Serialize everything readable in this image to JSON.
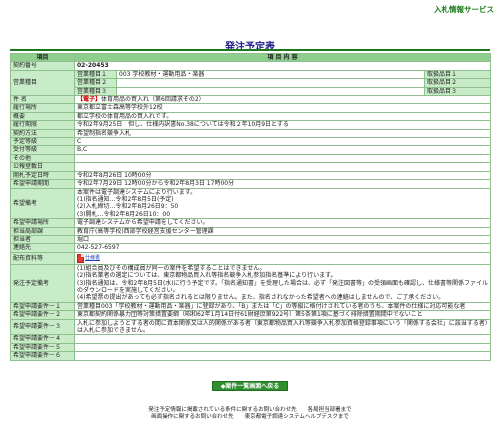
{
  "header": {
    "service": "入札情報サービス"
  },
  "page_title": "発注予定表",
  "table": {
    "head_item": "項目",
    "head_content": "項 目 内 容",
    "case_no": {
      "label": "契約番号",
      "value": "02-20453"
    },
    "category": {
      "label": "営業種目",
      "rows": [
        {
          "name": "営業種目１",
          "value": "003 学校教材・運動用品・楽器",
          "lic": "取扱品目１"
        },
        {
          "name": "営業種目２",
          "value": "",
          "lic": "取扱品目２"
        },
        {
          "name": "営業種目３",
          "value": "",
          "lic": "取扱品目３"
        }
      ]
    },
    "subject": {
      "label": "件 名",
      "tag": "【電子】",
      "value": "体育用品の買入れ（第6回請求その2）"
    },
    "place": {
      "label": "履行場所",
      "value": "東京都立富士森高等学校外12校"
    },
    "summary": {
      "label": "概要",
      "value": "都立学校の体育用品の買入れです。"
    },
    "period": {
      "label": "履行期限",
      "value": "令和2年9月25日　但し、仕様内訳書No.38については令和２年10月9日とする"
    },
    "method": {
      "label": "契約方法",
      "value": "希望制指名競争入札"
    },
    "pre_rank": {
      "label": "予定等級",
      "value": "C"
    },
    "accept_rank": {
      "label": "受付等級",
      "value": "B,C"
    },
    "other": {
      "label": "その他",
      "value": ""
    },
    "bid_date": {
      "label": "公報登載日",
      "value": ""
    },
    "open_date": {
      "label": "開札予定日時",
      "value": "令和2年8月26日 10時00分"
    },
    "apply_period": {
      "label": "希望申請期間",
      "value": "令和2年7月29日 12時00分から令和2年8月3日 17時00分"
    },
    "remarks": {
      "label": "希望備考",
      "lines": [
        "本案件は電子調達システムにより行います。",
        "(1)指名通知…令和2年8月5日(予定)",
        "(2)入札締切…令和2年8月26日9：50",
        "(3)開札…令和2年8月26日10：00"
      ]
    },
    "apply_place": {
      "label": "希望申請場所",
      "value": "電子調達システムから希望申請をしてください。"
    },
    "dept": {
      "label": "担当局部課",
      "value": "教育庁(高等学校)西部学校経営支援センター管理課"
    },
    "person": {
      "label": "担当者",
      "value": "堀口"
    },
    "tel": {
      "label": "連絡先",
      "value": "042-527-6597"
    },
    "docs": {
      "label": "配布資料等",
      "link": "仕様書"
    },
    "conditions": {
      "label": "発注予定備考",
      "lines": [
        "(1)組合員及びその構成員が同一の案件を希望することはできません。",
        "(2)指名業者の選定については、東京都物品買入れ等指名競争入札参加指名基準により行います。",
        "(3)指名通知は、令和2年8月5日(水)に行う予定です。「指名通知書」を受理した場合は、必ず「発注図書等」の受領画面も確認し、仕様書等関係ファイルのダウンロードを実施してください。",
        "(4)希望票の提出があっても必ず指名されるとは限りません。また、指名されなかった希望者への連絡はしませんので、ご了承ください。"
      ]
    },
    "req1": {
      "label": "希望申請要件－１",
      "value": "営業種目003「学校教材・運動用品・楽器」に登録があり、「B」または「C」の等級に格付けされている者のうち、本案件の仕様に対応可能な者"
    },
    "req2": {
      "label": "希望申請要件－２",
      "value": "東京都契約関係暴力団等対策措置要綱（昭和62年1月14日付61財経庶第922号）第5条第1項に基づく排除措置期間中でないこと"
    },
    "req3": {
      "label": "希望申請要件－３",
      "value": "入札に参加しようとする者の間に資本関係又は人的関係がある者（東京都物品買入れ等競争入札参加資格登録事項にいう「関係する会社」に該当する者）は入札に参加できません。"
    },
    "req4": {
      "label": "希望申請要件－４",
      "value": ""
    },
    "req5": {
      "label": "希望申請要件－５",
      "value": ""
    },
    "req6": {
      "label": "希望申請要件－６",
      "value": ""
    }
  },
  "back_button": "◆案件一覧画面へ戻る",
  "footer": {
    "line1": "発注予定情報に掲載されている条件に関するお問い合わせ先　　各局担当部署まで",
    "line2": "画面操作に関するお問い合わせ先　　東京都電子調達システムヘルプデスクまで"
  }
}
